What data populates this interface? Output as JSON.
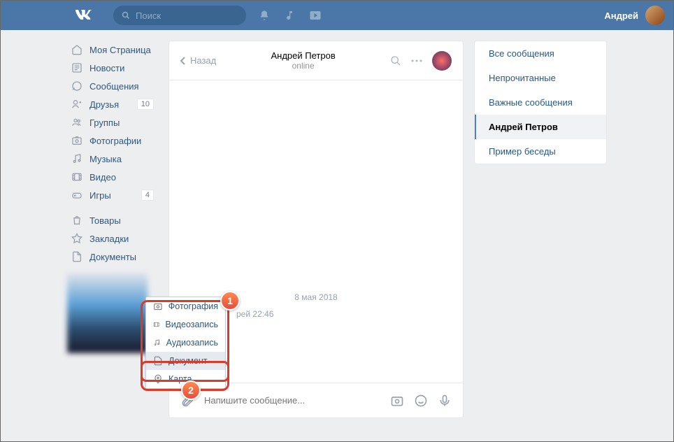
{
  "header": {
    "search_placeholder": "Поиск",
    "username": "Андрей"
  },
  "nav": {
    "items": [
      {
        "label": "Моя Страница"
      },
      {
        "label": "Новости"
      },
      {
        "label": "Сообщения"
      },
      {
        "label": "Друзья",
        "badge": "10"
      },
      {
        "label": "Группы"
      },
      {
        "label": "Фотографии"
      },
      {
        "label": "Музыка"
      },
      {
        "label": "Видео"
      },
      {
        "label": "Игры",
        "badge": "4"
      }
    ],
    "items2": [
      {
        "label": "Товары"
      },
      {
        "label": "Закладки"
      },
      {
        "label": "Документы"
      }
    ]
  },
  "chat": {
    "back": "Назад",
    "name": "Андрей Петров",
    "status": "online",
    "date": "8 мая 2018",
    "msg_meta_name": "рей",
    "msg_meta_time": "22:46",
    "input_placeholder": "Напишите сообщение..."
  },
  "right": {
    "items": [
      {
        "label": "Все сообщения"
      },
      {
        "label": "Непрочитанные"
      },
      {
        "label": "Важные сообщения"
      },
      {
        "label": "Андрей Петров",
        "active": true
      },
      {
        "label": "Пример беседы"
      }
    ]
  },
  "attach": {
    "items": [
      {
        "label": "Фотография"
      },
      {
        "label": "Видеозапись"
      },
      {
        "label": "Аудиозапись"
      },
      {
        "label": "Документ"
      },
      {
        "label": "Карта"
      }
    ]
  },
  "callouts": {
    "b1": "1",
    "b2": "2"
  }
}
